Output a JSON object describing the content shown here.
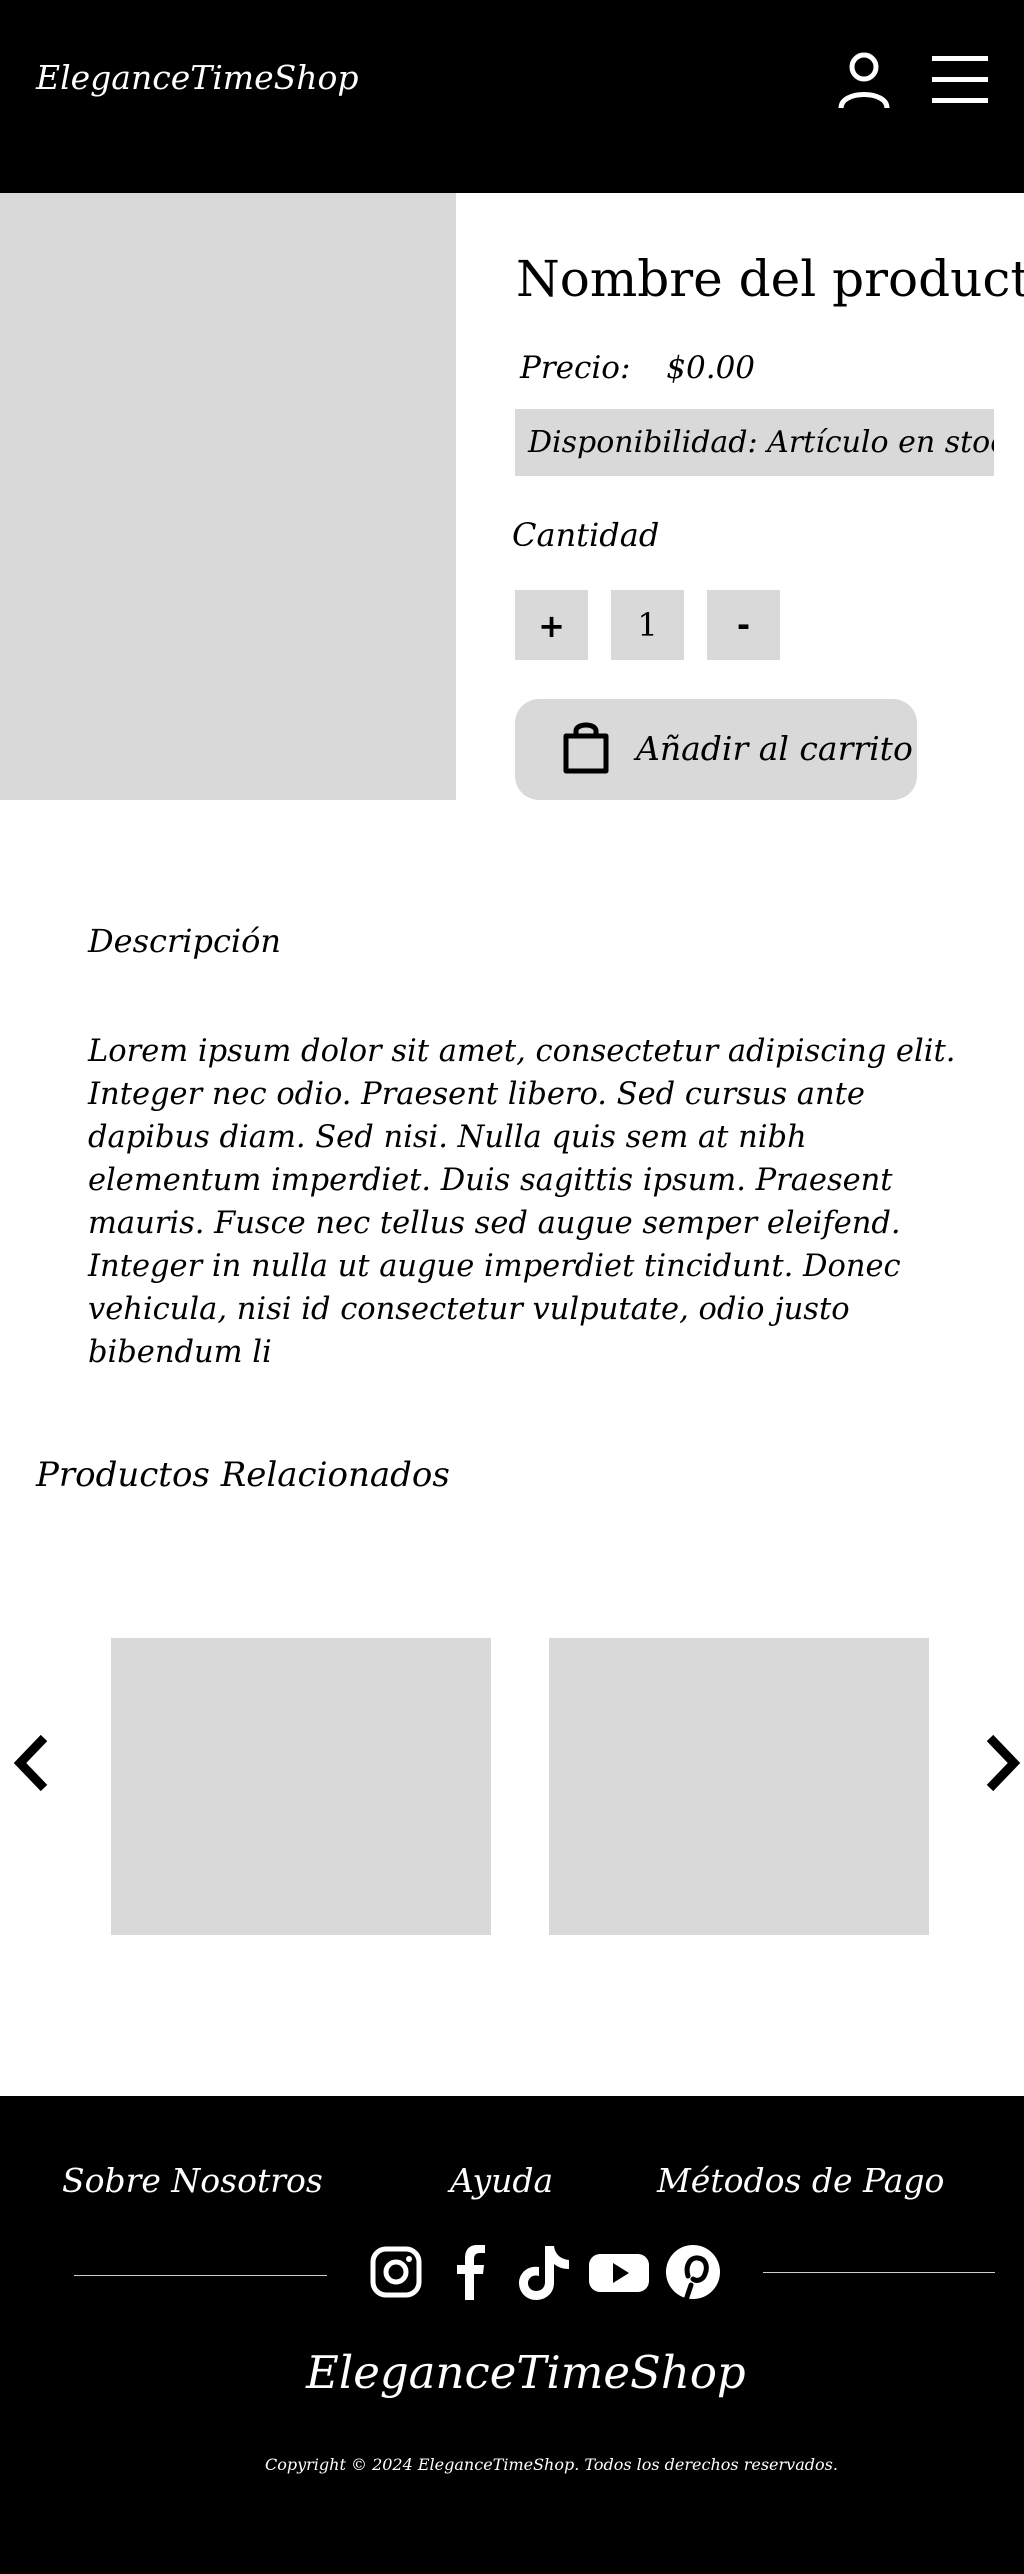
{
  "header": {
    "brand": "EleganceTimeShop",
    "user_icon": "user-icon",
    "menu_icon": "hamburger-menu-icon"
  },
  "product": {
    "title": "Nombre del producto",
    "price_label": "Precio:",
    "price_value": "$0.00",
    "availability": "Disponibilidad: Artículo en stock",
    "quantity_label": "Cantidad",
    "qty_plus": "+",
    "qty_value": "1",
    "qty_minus": "-",
    "add_to_cart": "Añadir al carrito",
    "cart_icon": "shopping-bag-icon"
  },
  "description": {
    "heading": "Descripción",
    "body": "Lorem ipsum dolor sit amet, consectetur adipiscing elit. Integer nec odio. Praesent libero. Sed cursus ante dapibus diam. Sed nisi. Nulla quis sem at nibh elementum imperdiet. Duis sagittis ipsum. Praesent mauris. Fusce nec tellus sed augue semper eleifend. Integer in nulla ut augue imperdiet tincidunt. Donec vehicula, nisi id consectetur vulputate, odio justo bibendum li"
  },
  "related": {
    "heading": "Productos Relacionados",
    "prev_icon": "chevron-left-icon",
    "next_icon": "chevron-right-icon"
  },
  "footer": {
    "links": [
      "Sobre Nosotros",
      "Ayuda",
      "Métodos de Pago"
    ],
    "social_icons": [
      "instagram-icon",
      "facebook-icon",
      "tiktok-icon",
      "youtube-icon",
      "pinterest-icon"
    ],
    "brand": "EleganceTimeShop",
    "copyright": "Copyright © 2024 EleganceTimeShop. Todos los derechos reservados."
  },
  "colors": {
    "header_bg": "#000000",
    "placeholder_gray": "#d9d9d9",
    "footer_bg": "#000000",
    "text_light": "#ffffff"
  }
}
